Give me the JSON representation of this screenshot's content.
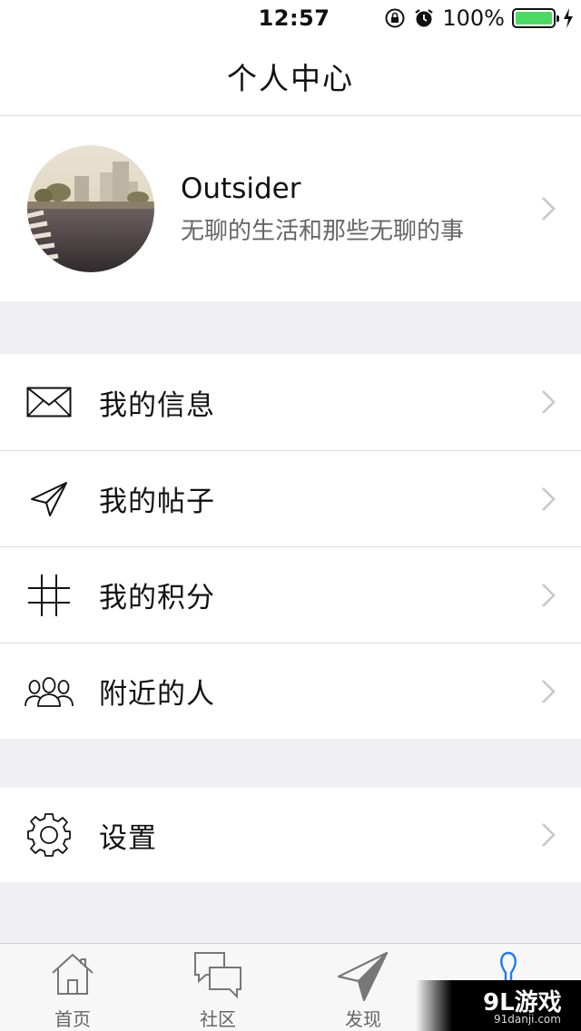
{
  "status_bar": {
    "time": "12:57",
    "battery_percent": "100%",
    "battery_level": 1.0,
    "icons": [
      "rotation-lock-icon",
      "alarm-icon",
      "battery-icon",
      "charging-icon"
    ]
  },
  "nav": {
    "title": "个人中心"
  },
  "profile": {
    "name": "Outsider",
    "bio": "无聊的生活和那些无聊的事"
  },
  "menu": [
    {
      "label": "我的信息",
      "icon": "envelope-icon"
    },
    {
      "label": "我的帖子",
      "icon": "paper-plane-icon"
    },
    {
      "label": "我的积分",
      "icon": "hash-grid-icon"
    },
    {
      "label": "附近的人",
      "icon": "people-group-icon"
    }
  ],
  "settings": {
    "label": "设置",
    "icon": "gear-icon"
  },
  "tabs": [
    {
      "label": "首页",
      "icon": "home-icon"
    },
    {
      "label": "社区",
      "icon": "chat-bubbles-icon"
    },
    {
      "label": "发现",
      "icon": "paper-plane-icon"
    },
    {
      "label": "",
      "icon": "person-icon",
      "active": true
    }
  ],
  "colors": {
    "accent": "#1a7cf2",
    "battery": "#4cd964",
    "background": "#efeff4"
  },
  "watermark": {
    "main": "9L游戏",
    "sub": "91danji.com"
  }
}
